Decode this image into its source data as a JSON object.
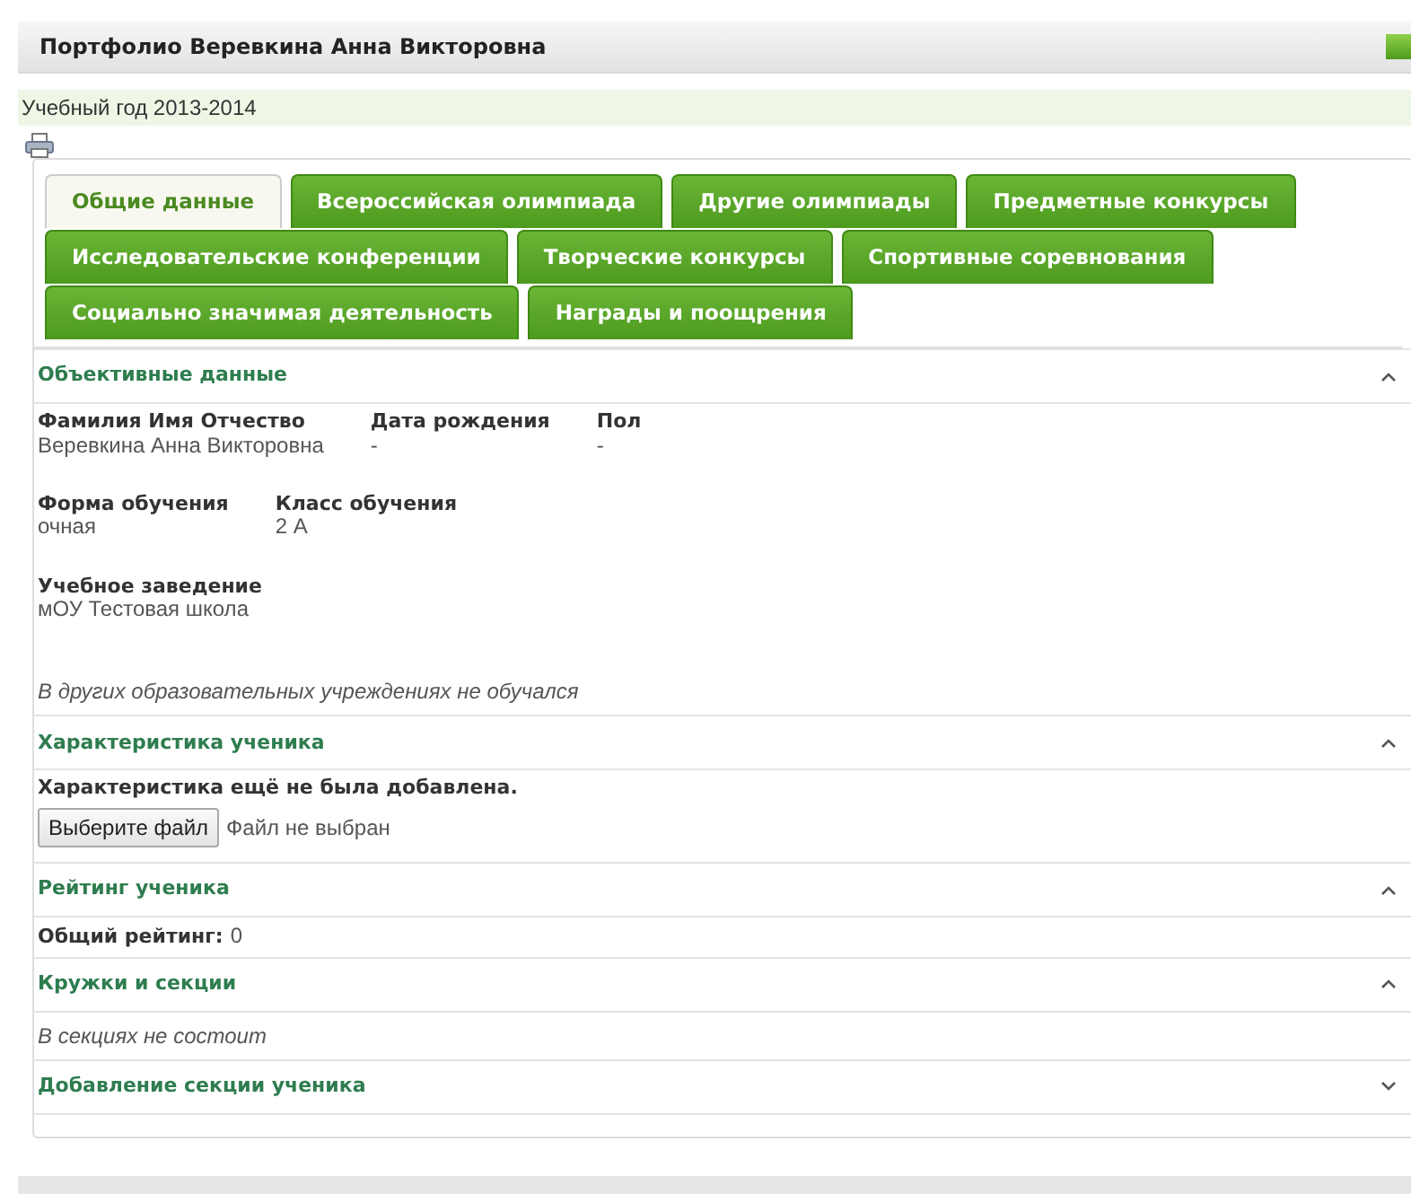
{
  "header": {
    "title": "Портфолио Веревкина Анна Викторовна"
  },
  "school_year": "Учебный год 2013-2014",
  "tabs": [
    {
      "label": "Общие данные",
      "selected": true
    },
    {
      "label": "Всероссийская олимпиада",
      "selected": false
    },
    {
      "label": "Другие олимпиады",
      "selected": false
    },
    {
      "label": "Предметные конкурсы",
      "selected": false
    },
    {
      "label": "Исследовательские конференции",
      "selected": false
    },
    {
      "label": "Творческие конкурсы",
      "selected": false
    },
    {
      "label": "Спортивные соревнования",
      "selected": false
    },
    {
      "label": "Социально значимая деятельность",
      "selected": false
    },
    {
      "label": "Награды и поощрения",
      "selected": false
    }
  ],
  "sections": [
    {
      "title": "Объективные данные",
      "expanded": true,
      "kind": "fields",
      "field_rows": [
        [
          {
            "label": "Фамилия Имя Отчество",
            "value": "Веревкина Анна Викторовна"
          },
          {
            "label": "Дата рождения",
            "value": "-"
          },
          {
            "label": "Пол",
            "value": "-"
          }
        ],
        [
          {
            "label": "Форма обучения",
            "value": "очная"
          },
          {
            "label": "Класс обучения",
            "value": "2 А"
          }
        ],
        [
          {
            "label": "Учебное заведение",
            "value": "мОУ Тестовая школа"
          }
        ]
      ],
      "note": "В других образовательных учреждениях не обучался"
    },
    {
      "title": "Характеристика ученика",
      "expanded": true,
      "kind": "upload",
      "message": "Характеристика ещё не была добавлена.",
      "button": "Выберите файл",
      "file_status": "Файл не выбран"
    },
    {
      "title": "Рейтинг ученика",
      "expanded": true,
      "kind": "rating",
      "label": "Общий рейтинг:",
      "value": "0"
    },
    {
      "title": "Кружки и секции",
      "expanded": true,
      "kind": "note",
      "note": "В секциях не состоит"
    },
    {
      "title": "Добавление секции ученика",
      "expanded": false
    }
  ]
}
